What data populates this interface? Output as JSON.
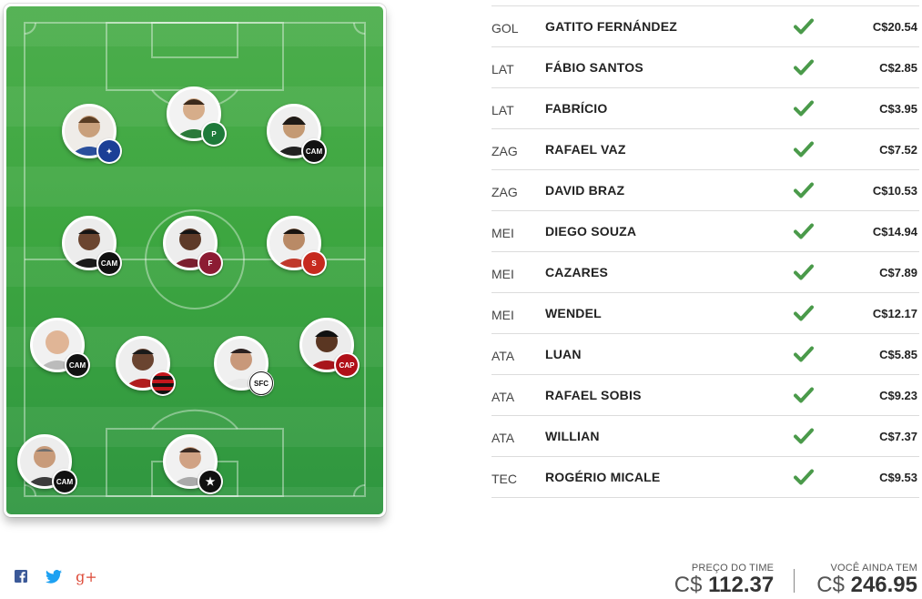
{
  "colors": {
    "pitch": "#3da640",
    "check": "#4a9a4a",
    "share_facebook": "#3b5998",
    "share_twitter": "#1da1f2",
    "share_gplus": "#dd4b39"
  },
  "field": {
    "players": [
      {
        "id": "p-goal",
        "club_icon": "botafogo-crest"
      },
      {
        "id": "p-lat-left",
        "club_icon": "atletico-mg-crest"
      },
      {
        "id": "p-zag-1",
        "club_icon": "flamengo-crest"
      },
      {
        "id": "p-zag-2",
        "club_icon": "santos-crest"
      },
      {
        "id": "p-lat-right",
        "club_icon": "atletico-pr-crest"
      },
      {
        "id": "p-mei-1",
        "club_icon": "atletico-mg-crest"
      },
      {
        "id": "p-mei-2",
        "club_icon": "fluminense-crest"
      },
      {
        "id": "p-mei-3",
        "club_icon": "sport-crest"
      },
      {
        "id": "p-ata-1",
        "club_icon": "cruzeiro-crest"
      },
      {
        "id": "p-ata-2",
        "club_icon": "palmeiras-crest"
      },
      {
        "id": "p-ata-3",
        "club_icon": "atletico-mg-crest"
      },
      {
        "id": "p-tec",
        "club_icon": "atletico-mg-crest"
      }
    ]
  },
  "lineup": [
    {
      "pos": "GOL",
      "name": "GATITO FERNÁNDEZ",
      "price": "C$20.54"
    },
    {
      "pos": "LAT",
      "name": "FÁBIO SANTOS",
      "price": "C$2.85"
    },
    {
      "pos": "LAT",
      "name": "FABRÍCIO",
      "price": "C$3.95"
    },
    {
      "pos": "ZAG",
      "name": "RAFAEL VAZ",
      "price": "C$7.52"
    },
    {
      "pos": "ZAG",
      "name": "DAVID BRAZ",
      "price": "C$10.53"
    },
    {
      "pos": "MEI",
      "name": "DIEGO SOUZA",
      "price": "C$14.94"
    },
    {
      "pos": "MEI",
      "name": "CAZARES",
      "price": "C$7.89"
    },
    {
      "pos": "MEI",
      "name": "WENDEL",
      "price": "C$12.17"
    },
    {
      "pos": "ATA",
      "name": "LUAN",
      "price": "C$5.85"
    },
    {
      "pos": "ATA",
      "name": "RAFAEL SOBIS",
      "price": "C$9.23"
    },
    {
      "pos": "ATA",
      "name": "WILLIAN",
      "price": "C$7.37"
    },
    {
      "pos": "TEC",
      "name": "ROGÉRIO MICALE",
      "price": "C$9.53"
    }
  ],
  "totals": {
    "team_price_label": "PREÇO DO TIME",
    "team_price_currency": "C$",
    "team_price_value": "112.37",
    "remaining_label": "VOCÊ AINDA TEM",
    "remaining_currency": "C$",
    "remaining_value": "246.95"
  },
  "share": {
    "icons": [
      "facebook-icon",
      "twitter-icon",
      "google-plus-icon"
    ],
    "gplus_glyph": "g+"
  }
}
